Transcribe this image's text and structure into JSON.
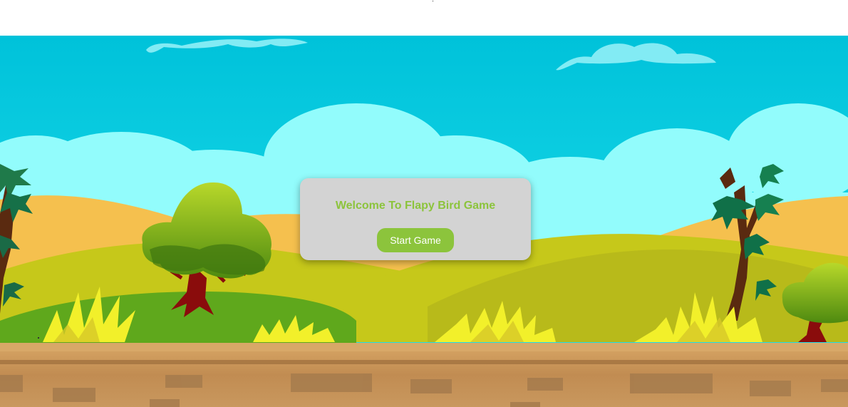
{
  "welcome": {
    "title": "Welcome To Flapy Bird Game",
    "start_button_label": "Start Game"
  },
  "colors": {
    "sky_top": "#00c4dc",
    "sky_bottom": "#30e4f0",
    "cloud": "#90fcfc",
    "sand_hill": "#f5c04e",
    "green_hill": "#c4c818",
    "grass": "#6ab420",
    "ground": "#c8955a",
    "brick": "#a47a4c",
    "dialog_bg": "#d3d3d3",
    "accent_green": "#8cc43c",
    "button_text": "#ffffff"
  }
}
